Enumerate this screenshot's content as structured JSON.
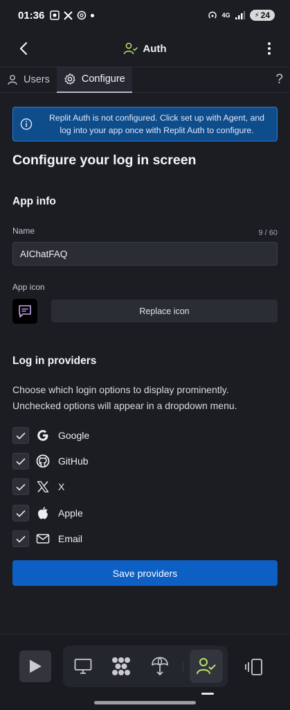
{
  "status_bar": {
    "time": "01:36",
    "network": "4G",
    "battery": "24"
  },
  "header": {
    "title": "Auth"
  },
  "tabs": [
    {
      "label": "Users",
      "icon": "person-icon",
      "active": false
    },
    {
      "label": "Configure",
      "icon": "gear-icon",
      "active": true
    }
  ],
  "help_label": "?",
  "banner": {
    "text": "Replit Auth is not configured. Click set up with Agent, and log into your app once with Replit Auth to configure."
  },
  "page_title": "Configure your log in screen",
  "app_info": {
    "section_title": "App info",
    "name_label": "Name",
    "name_value": "AIChatFAQ",
    "name_counter": "9 / 60",
    "icon_label": "App icon",
    "replace_icon_label": "Replace icon"
  },
  "providers": {
    "section_title": "Log in providers",
    "description": "Choose which login options to display prominently. Unchecked options will appear in a dropdown menu.",
    "items": [
      {
        "label": "Google",
        "icon": "google-icon",
        "checked": true
      },
      {
        "label": "GitHub",
        "icon": "github-icon",
        "checked": true
      },
      {
        "label": "X",
        "icon": "x-icon",
        "checked": true
      },
      {
        "label": "Apple",
        "icon": "apple-icon",
        "checked": true
      },
      {
        "label": "Email",
        "icon": "mail-icon",
        "checked": true
      }
    ],
    "save_label": "Save providers"
  },
  "bottom_nav": {
    "items": [
      "play-icon",
      "monitor-icon",
      "workspace-icon",
      "deploy-icon",
      "auth-user-icon",
      "panel-icon"
    ],
    "active": "auth-user-icon"
  },
  "colors": {
    "background": "#1c1d23",
    "banner_bg": "#0f4c8a",
    "primary_button": "#0d5fc4",
    "auth_accent": "#b9e46a"
  }
}
